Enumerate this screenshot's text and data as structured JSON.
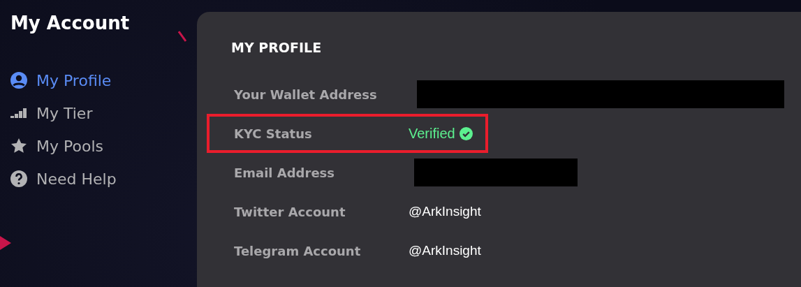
{
  "sidebar": {
    "title": "My Account",
    "items": [
      {
        "label": "My Profile",
        "selected": true
      },
      {
        "label": "My Tier",
        "selected": false
      },
      {
        "label": "My Pools",
        "selected": false
      },
      {
        "label": "Need Help",
        "selected": false
      }
    ]
  },
  "profile": {
    "title": "MY PROFILE",
    "rows": [
      {
        "label": "Your Wallet Address",
        "kind": "redacted",
        "highlighted": false
      },
      {
        "label": "KYC Status",
        "kind": "verified",
        "value": "Verified",
        "highlighted": true
      },
      {
        "label": "Email Address",
        "kind": "redacted",
        "highlighted": false
      },
      {
        "label": "Twitter Account",
        "kind": "text",
        "value": "@ArkInsight",
        "highlighted": false
      },
      {
        "label": "Telegram Account",
        "kind": "text",
        "value": "@ArkInsight",
        "highlighted": false
      }
    ]
  }
}
